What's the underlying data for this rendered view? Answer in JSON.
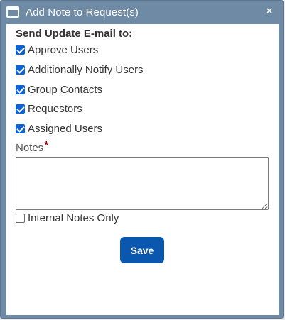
{
  "dialog": {
    "title": "Add Note to Request(s)",
    "close_label": "×",
    "heading": "Send Update E-mail to:",
    "recipients": [
      {
        "label": "Approve Users",
        "checked": true
      },
      {
        "label": "Additionally Notify Users",
        "checked": true
      },
      {
        "label": "Group Contacts",
        "checked": true
      },
      {
        "label": "Requestors",
        "checked": true
      },
      {
        "label": "Assigned Users",
        "checked": true
      }
    ],
    "notes": {
      "label": "Notes",
      "required_marker": "*",
      "value": ""
    },
    "internal_only": {
      "label": "Internal Notes Only",
      "checked": false
    },
    "save_label": "Save"
  },
  "colors": {
    "frame": "#6f8aa4",
    "checkbox_accent": "#0b63d6",
    "save_button": "#0a57b0",
    "required": "#8b0000"
  }
}
